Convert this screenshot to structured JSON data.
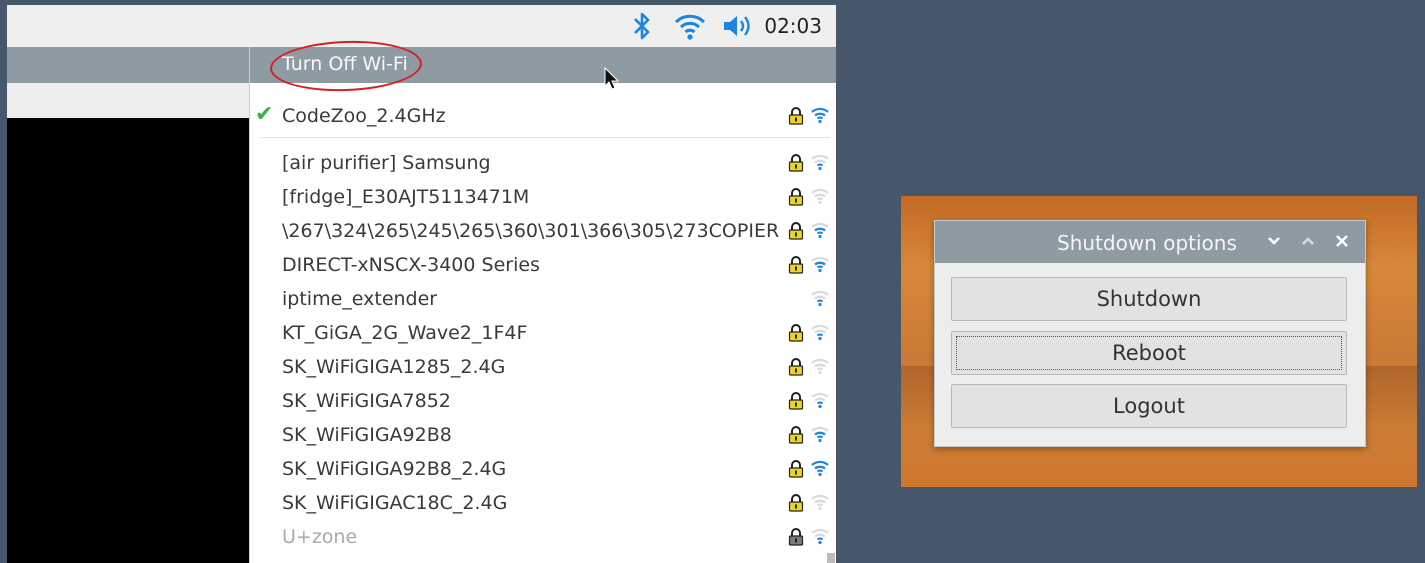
{
  "taskbar": {
    "clock": "02:03",
    "icons": [
      "bluetooth-icon",
      "wifi-icon",
      "volume-icon"
    ],
    "accent": "#1a86e0"
  },
  "wifi_menu": {
    "toggle_label": "Turn Off Wi-Fi",
    "connected": {
      "name": "CodeZoo_2.4GHz",
      "secured": true,
      "signal": "strong"
    },
    "networks": [
      {
        "name": "[air purifier] Samsung",
        "secured": true,
        "signal": "weak"
      },
      {
        "name": "[fridge]_E30AJT5113471M",
        "secured": true,
        "signal": "none"
      },
      {
        "name": "\\267\\324\\265\\245\\265\\360\\301\\366\\305\\273COPIER",
        "secured": true,
        "signal": "medium"
      },
      {
        "name": "DIRECT-xNSCX-3400 Series",
        "secured": true,
        "signal": "medium"
      },
      {
        "name": "iptime_extender",
        "secured": false,
        "signal": "weak"
      },
      {
        "name": "KT_GiGA_2G_Wave2_1F4F",
        "secured": true,
        "signal": "weak"
      },
      {
        "name": "SK_WiFiGIGA1285_2.4G",
        "secured": true,
        "signal": "none"
      },
      {
        "name": "SK_WiFiGIGA7852",
        "secured": true,
        "signal": "weak"
      },
      {
        "name": "SK_WiFiGIGA92B8",
        "secured": true,
        "signal": "medium"
      },
      {
        "name": "SK_WiFiGIGA92B8_2.4G",
        "secured": true,
        "signal": "strong"
      },
      {
        "name": "SK_WiFiGIGAC18C_2.4G",
        "secured": true,
        "signal": "none"
      },
      {
        "name": "U+zone",
        "secured": true,
        "signal": "weak",
        "dimmed": true
      }
    ]
  },
  "shutdown_dialog": {
    "title": "Shutdown options",
    "buttons": {
      "shutdown": "Shutdown",
      "reboot": "Reboot",
      "logout": "Logout"
    }
  }
}
